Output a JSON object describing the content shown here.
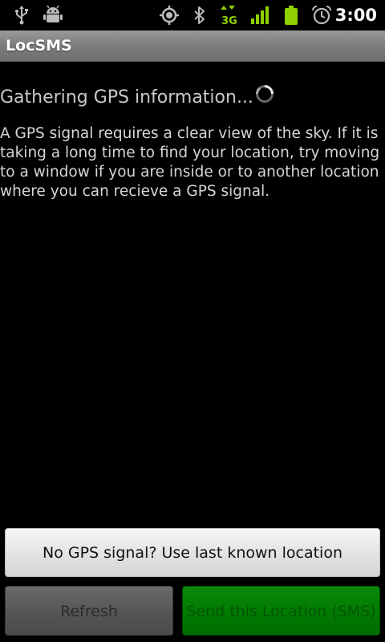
{
  "status_bar": {
    "time": "3:00",
    "network_label": "3G",
    "icons": [
      "usb-icon",
      "android-debug-icon",
      "gps-icon",
      "bluetooth-icon",
      "3g-data-icon",
      "signal-icon",
      "battery-icon",
      "alarm-icon"
    ]
  },
  "app": {
    "title": "LocSMS"
  },
  "content": {
    "status_text": "Gathering GPS information...",
    "info_text": "A GPS signal requires a clear view of the sky. If it is taking a long time to find your location, try moving to a window if you are inside or to another location where you can recieve a GPS signal."
  },
  "buttons": {
    "use_last_label": "No GPS signal? Use last known location",
    "refresh_label": "Refresh",
    "send_label": "Send this Location (SMS)"
  },
  "colors": {
    "background": "#000000",
    "title_bar": "#8a8a8a",
    "send_button": "#007a00",
    "status_green": "#8fd100"
  }
}
